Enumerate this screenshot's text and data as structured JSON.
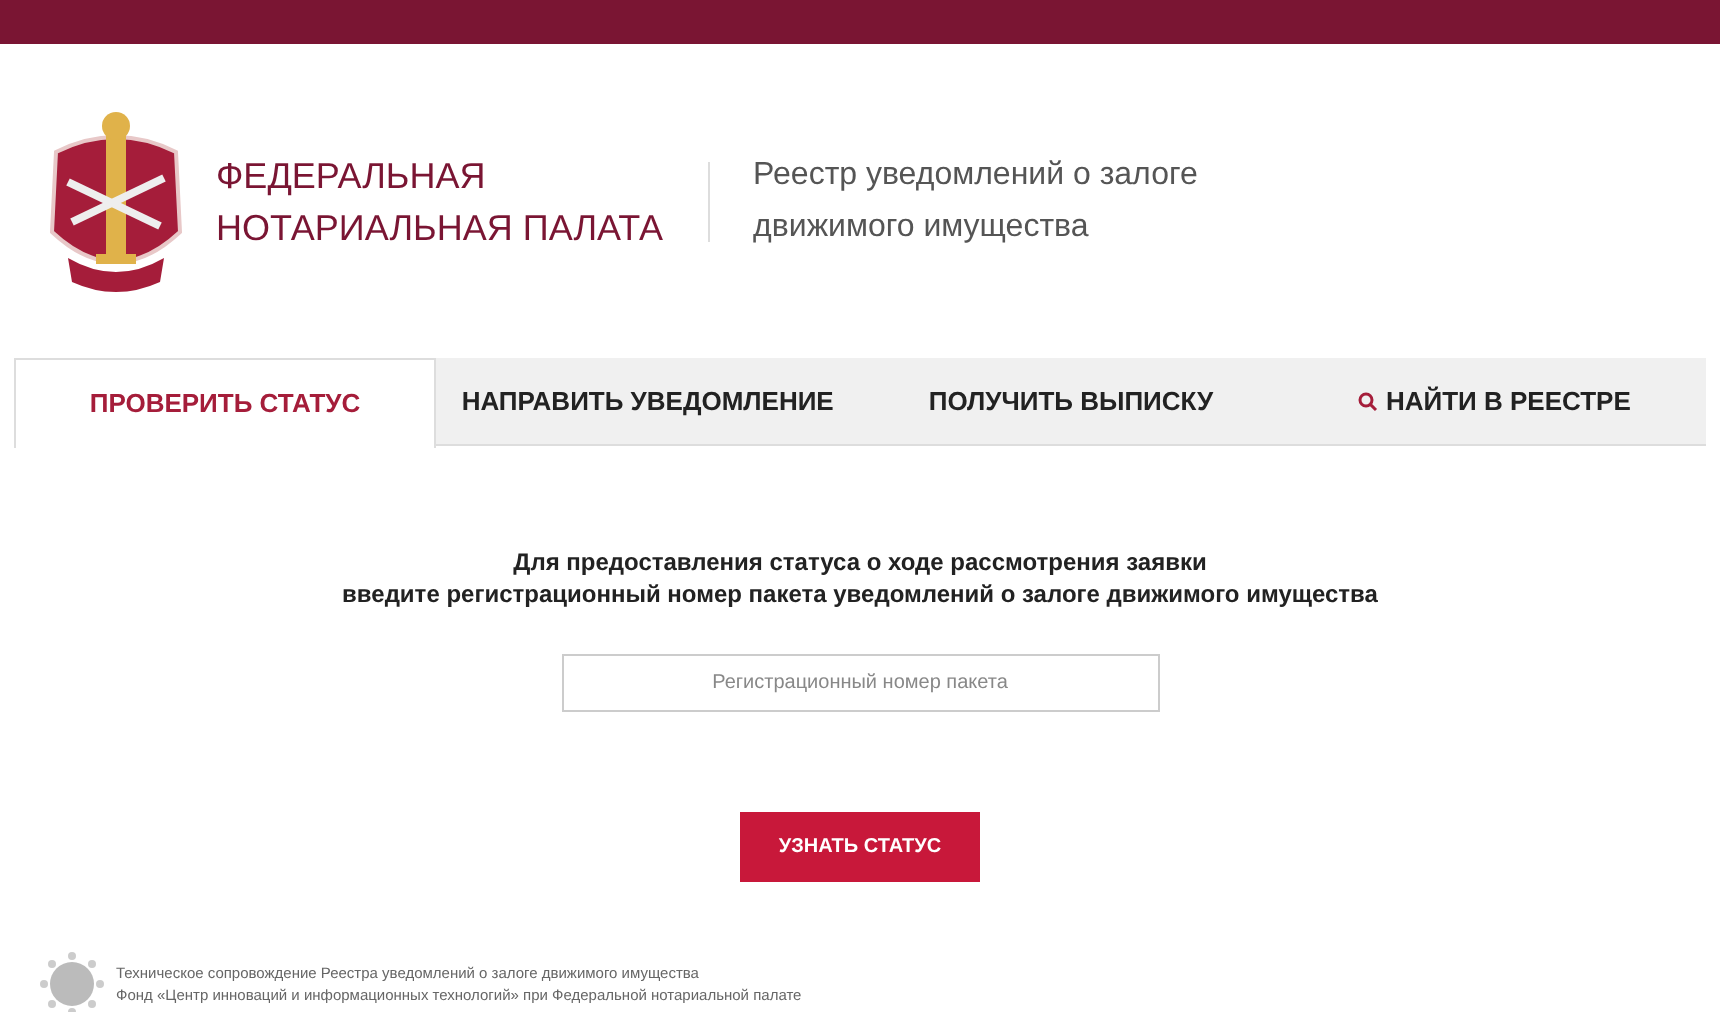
{
  "org_name": [
    "ФЕДЕРАЛЬНАЯ",
    "НОТАРИАЛЬНАЯ ПАЛАТА"
  ],
  "registry_title": [
    "Реестр уведомлений о залоге",
    "движимого имущества"
  ],
  "tabs": [
    {
      "label": "ПРОВЕРИТЬ СТАТУС",
      "selected": true
    },
    {
      "label": "НАПРАВИТЬ УВЕДОМЛЕНИЕ",
      "selected": false
    },
    {
      "label": "ПОЛУЧИТЬ ВЫПИСКУ",
      "selected": false
    },
    {
      "label": "НАЙТИ В РЕЕСТРЕ",
      "selected": false,
      "kind": "search"
    }
  ],
  "instructions": [
    "Для предоставления статуса о ходе рассмотрения заявки",
    "введите регистрационный номер пакета уведомлений о залоге движимого имущества"
  ],
  "package_number": {
    "placeholder": "Регистрационный номер пакета"
  },
  "submit_button": "УЗНАТЬ СТАТУС",
  "footer": [
    "Техническое сопровождение Реестра уведомлений о залоге движимого имущества",
    "Фонд «Центр инноваций и информационных технологий» при Федеральной нотариальной палате"
  ]
}
